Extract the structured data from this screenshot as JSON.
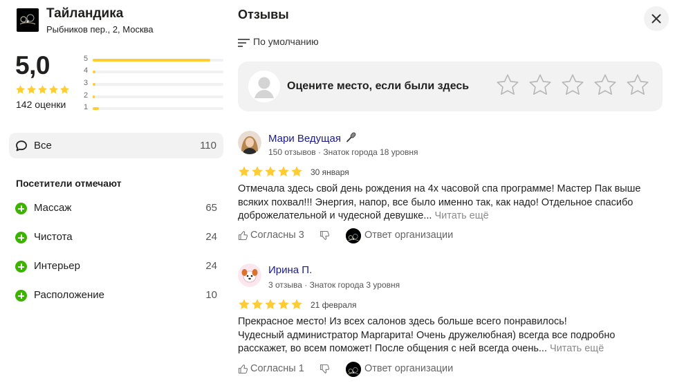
{
  "organization": {
    "name": "Тайландика",
    "address": "Рыбников пер., 2, Москва",
    "rating": "5,0",
    "rating_count": "142 оценки",
    "distribution": [
      {
        "star": "5",
        "share": 0.9
      },
      {
        "star": "4",
        "share": 0.02
      },
      {
        "star": "3",
        "share": 0.02
      },
      {
        "star": "2",
        "share": 0.01
      },
      {
        "star": "1",
        "share": 0.05
      }
    ]
  },
  "filters": {
    "all": {
      "label": "Все",
      "count": "110"
    }
  },
  "aspects": {
    "title": "Посетители отмечают",
    "items": [
      {
        "label": "Массаж",
        "count": "65"
      },
      {
        "label": "Чистота",
        "count": "24"
      },
      {
        "label": "Интерьер",
        "count": "24"
      },
      {
        "label": "Расположение",
        "count": "10"
      }
    ]
  },
  "reviews_panel": {
    "title": "Отзывы",
    "sort_label": "По умолчанию",
    "rate_prompt": "Оцените место, если были здесь"
  },
  "reviews": [
    {
      "author": "Мари Ведущая",
      "meta": "150 отзывов · Знаток города 18 уровня",
      "rating": 5,
      "date": "30 января",
      "text": "Отмечала здесь свой день рождения на 4х часовой спа программе! Мастер Пак выше всяких похвал!!! Энергия, напор, все было именно так, как надо! Отдельное спасибо доброжелательной и чудесной девушке...",
      "read_more": "Читать ещё",
      "agree": "Согласны 3",
      "org_reply": "Ответ организации"
    },
    {
      "author": "Ирина П.",
      "meta": "3 отзыва · Знаток города 3 уровня",
      "rating": 5,
      "date": "21 февраля",
      "text_lines": [
        "Прекрасное место! Из всех салонов здесь больше всего понравилось!",
        "Чудесный администратор Маргарита! Очень дружелюбная) всегда все подробно расскажет, во всем поможет! После общения с ней всегда очень..."
      ],
      "read_more": "Читать ещё",
      "agree": "Согласны 1",
      "org_reply": "Ответ организации"
    }
  ],
  "colors": {
    "star": "#ffcc00",
    "accent_green": "#3bb300",
    "author_link": "#1a1a8c"
  },
  "icons": [
    "close-icon",
    "sort-icon",
    "chat-icon",
    "plus-icon",
    "star-icon",
    "thumb-up-icon",
    "thumb-down-icon",
    "microphone-icon"
  ]
}
